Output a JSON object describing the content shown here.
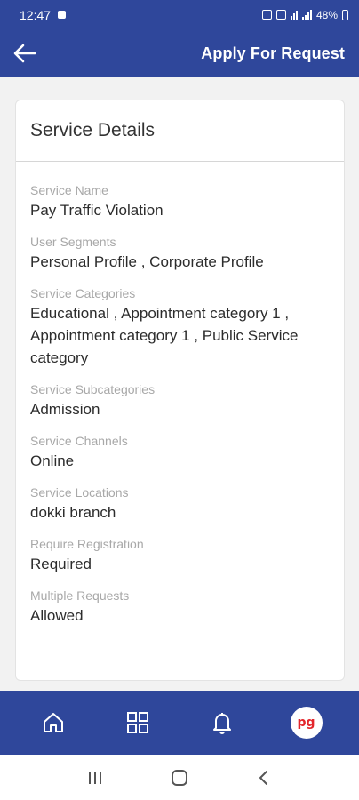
{
  "status_bar": {
    "time": "12:47",
    "battery": "48%",
    "icons": [
      "messenger-icon",
      "alarm-icon",
      "nfc-icon",
      "volte-icon",
      "signal-icon",
      "battery-icon"
    ]
  },
  "header": {
    "title": "Apply For Request",
    "back_icon": "arrow-left-icon"
  },
  "card": {
    "title": "Service Details",
    "fields": [
      {
        "label": "Service Name",
        "value": "Pay Traffic Violation"
      },
      {
        "label": "User Segments",
        "value": "Personal Profile , Corporate Profile"
      },
      {
        "label": "Service Categories",
        "value": "Educational , Appointment category 1 , Appointment category 1 , Public Service category"
      },
      {
        "label": "Service Subcategories",
        "value": "Admission"
      },
      {
        "label": "Service Channels",
        "value": "Online"
      },
      {
        "label": "Service Locations",
        "value": "dokki branch"
      },
      {
        "label": "Require Registration",
        "value": "Required"
      },
      {
        "label": "Multiple Requests",
        "value": "Allowed"
      }
    ]
  },
  "bottom_nav": {
    "items": [
      "home-icon",
      "dashboard-icon",
      "bell-icon",
      "profile-avatar"
    ],
    "avatar_text": "pg"
  },
  "system_nav": [
    "recent-apps-icon",
    "home-circle-icon",
    "back-chevron-icon"
  ],
  "colors": {
    "primary": "#2f479b",
    "background": "#f2f2f2",
    "label": "#a8a8a8",
    "value": "#2c2c2c",
    "avatar_text": "#e3262b"
  }
}
